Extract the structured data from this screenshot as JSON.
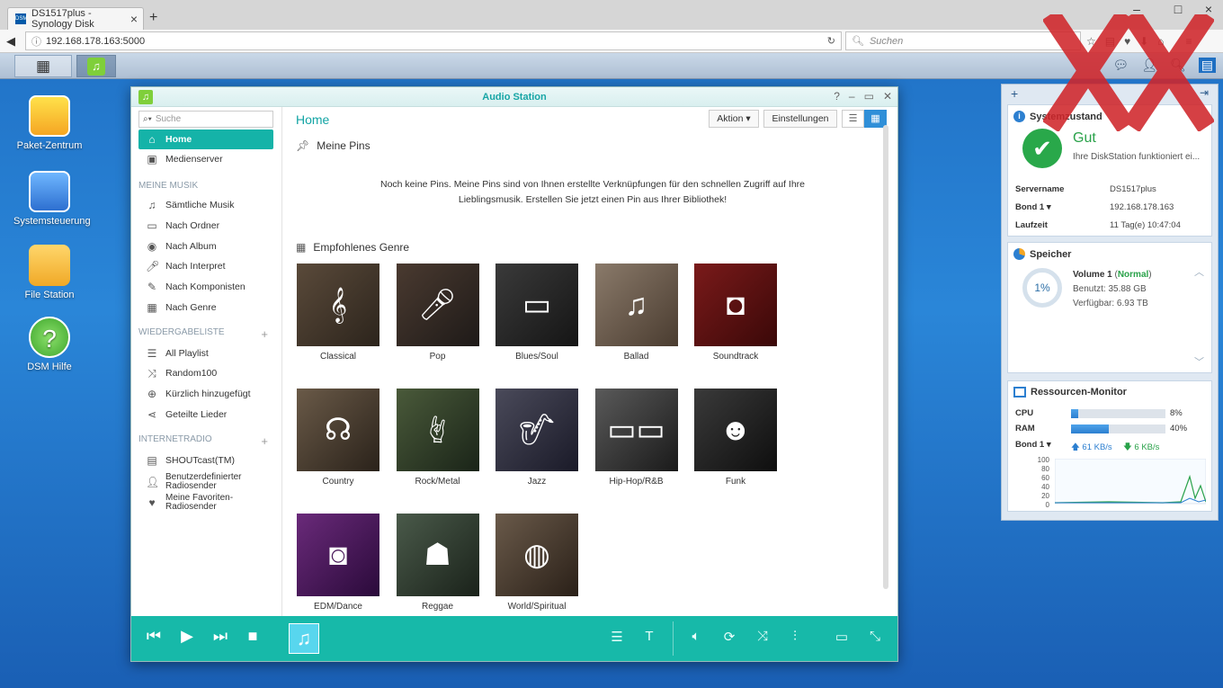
{
  "browser": {
    "tab_title": "DS1517plus - Synology Disk",
    "url": "192.168.178.163:5000",
    "search_placeholder": "Suchen"
  },
  "desktop": {
    "icons": [
      {
        "label": "Paket-Zentrum"
      },
      {
        "label": "Systemsteuerung"
      },
      {
        "label": "File Station"
      },
      {
        "label": "DSM Hilfe"
      }
    ]
  },
  "window": {
    "title": "Audio Station",
    "search_placeholder": "Suche",
    "main_title": "Home",
    "action_label": "Aktion",
    "settings_label": "Einstellungen",
    "pins_header": "Meine Pins",
    "pins_message_line1": "Noch keine Pins. Meine Pins sind von Ihnen erstellte Verknüpfungen für den schnellen Zugriff auf Ihre",
    "pins_message_line2": "Lieblingsmusik. Erstellen Sie jetzt einen Pin aus Ihrer Bibliothek!",
    "genre_header": "Empfohlenes Genre"
  },
  "sidebar": {
    "top": [
      "Home",
      "Medienserver"
    ],
    "section_music": "MEINE MUSIK",
    "music": [
      "Sämtliche Musik",
      "Nach Ordner",
      "Nach Album",
      "Nach Interpret",
      "Nach Komponisten",
      "Nach Genre"
    ],
    "section_playlist": "WIEDERGABELISTE",
    "playlist": [
      "All Playlist",
      "Random100",
      "Kürzlich hinzugefügt",
      "Geteilte Lieder"
    ],
    "section_radio": "INTERNETRADIO",
    "radio": [
      "SHOUTcast(TM)",
      "Benutzerdefinierter Radiosender",
      "Meine Favoriten-Radiosender"
    ]
  },
  "genres": [
    "Classical",
    "Pop",
    "Blues/Soul",
    "Ballad",
    "Soundtrack",
    "Country",
    "Rock/Metal",
    "Jazz",
    "Hip-Hop/R&B",
    "Funk",
    "EDM/Dance",
    "Reggae",
    "World/Spiritual"
  ],
  "widgets": {
    "system": {
      "title": "Systemzustand",
      "status": "Gut",
      "status_text": "Ihre DiskStation funktioniert ei...",
      "rows": [
        {
          "k": "Servername",
          "v": "DS1517plus"
        },
        {
          "k": "Bond 1 ▾",
          "v": "192.168.178.163"
        },
        {
          "k": "Laufzeit",
          "v": "11 Tag(e) 10:47:04"
        }
      ]
    },
    "storage": {
      "title": "Speicher",
      "percent": "1%",
      "volume": "Volume 1",
      "volume_status": "Normal",
      "used": "Benutzt: 35.88 GB",
      "free": "Verfügbar: 6.93 TB"
    },
    "resource": {
      "title": "Ressourcen-Monitor",
      "cpu_label": "CPU",
      "cpu": 8,
      "cpu_text": "8%",
      "ram_label": "RAM",
      "ram": 40,
      "ram_text": "40%",
      "net_label": "Bond 1 ▾",
      "up": "61 KB/s",
      "down": "6 KB/s",
      "y_ticks": [
        "100",
        "80",
        "60",
        "40",
        "20",
        "0"
      ]
    }
  },
  "colors": {
    "accent": "#15b3a8",
    "player": "#17b9a9",
    "ok": "#29a84a"
  }
}
